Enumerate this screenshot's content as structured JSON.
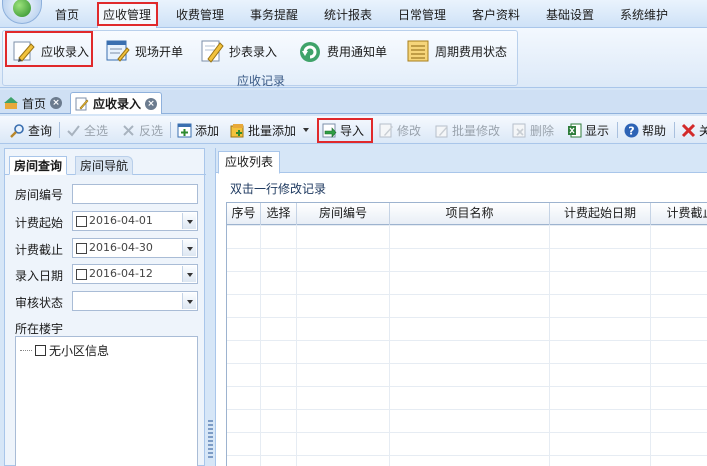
{
  "menu": {
    "items": [
      "首页",
      "应收管理",
      "收费管理",
      "事务提醒",
      "统计报表",
      "日常管理",
      "客户资料",
      "基础设置",
      "系统维护"
    ],
    "active": "应收管理"
  },
  "ribbon": {
    "buttons": [
      {
        "label": "应收录入",
        "icon": "pencil-edit-icon"
      },
      {
        "label": "现场开单",
        "icon": "form-edit-icon"
      },
      {
        "label": "抄表录入",
        "icon": "meter-pencil-icon"
      },
      {
        "label": "费用通知单",
        "icon": "notice-arrow-icon"
      },
      {
        "label": "周期费用状态",
        "icon": "ledger-icon"
      }
    ],
    "group_caption": "应收记录"
  },
  "doc_tabs": [
    {
      "label": "首页",
      "icon": "home-icon"
    },
    {
      "label": "应收录入",
      "icon": "edit-doc-icon"
    }
  ],
  "toolbar": {
    "buttons": [
      {
        "label": "查询",
        "icon": "search-icon",
        "enabled": true
      },
      {
        "label": "全选",
        "icon": "check-icon",
        "enabled": false
      },
      {
        "label": "反选",
        "icon": "cross-icon",
        "enabled": false
      },
      {
        "label": "添加",
        "icon": "add-icon",
        "enabled": true
      },
      {
        "label": "批量添加",
        "icon": "batch-add-icon",
        "enabled": true
      },
      {
        "label": "导入",
        "icon": "import-icon",
        "enabled": true
      },
      {
        "label": "修改",
        "icon": "edit-icon",
        "enabled": false
      },
      {
        "label": "批量修改",
        "icon": "batch-edit-icon",
        "enabled": false
      },
      {
        "label": "删除",
        "icon": "delete-icon",
        "enabled": false
      },
      {
        "label": "显示",
        "icon": "excel-icon",
        "enabled": true
      },
      {
        "label": "帮助",
        "icon": "help-icon",
        "enabled": true
      },
      {
        "label": "关",
        "icon": "close-red-icon",
        "enabled": true
      }
    ]
  },
  "left_panel": {
    "tabs": [
      "房间查询",
      "房间导航"
    ],
    "fields": {
      "room_no_label": "房间编号",
      "room_no_value": "",
      "charge_start_label": "计费起始",
      "charge_start_value": "2016-04-01",
      "charge_end_label": "计费截止",
      "charge_end_value": "2016-04-30",
      "entry_date_label": "录入日期",
      "entry_date_value": "2016-04-12",
      "audit_label": "审核状态",
      "audit_value": "",
      "building_label": "所在楼宇"
    },
    "tree": [
      "无小区信息"
    ]
  },
  "right_panel": {
    "tab": "应收列表",
    "hint": "双击一行修改记录",
    "columns": [
      "序号",
      "选择",
      "房间编号",
      "项目名称",
      "计费起始日期",
      "计费截止"
    ]
  },
  "colors": {
    "highlight": "#e0292b",
    "accent": "#3a6fb0"
  }
}
